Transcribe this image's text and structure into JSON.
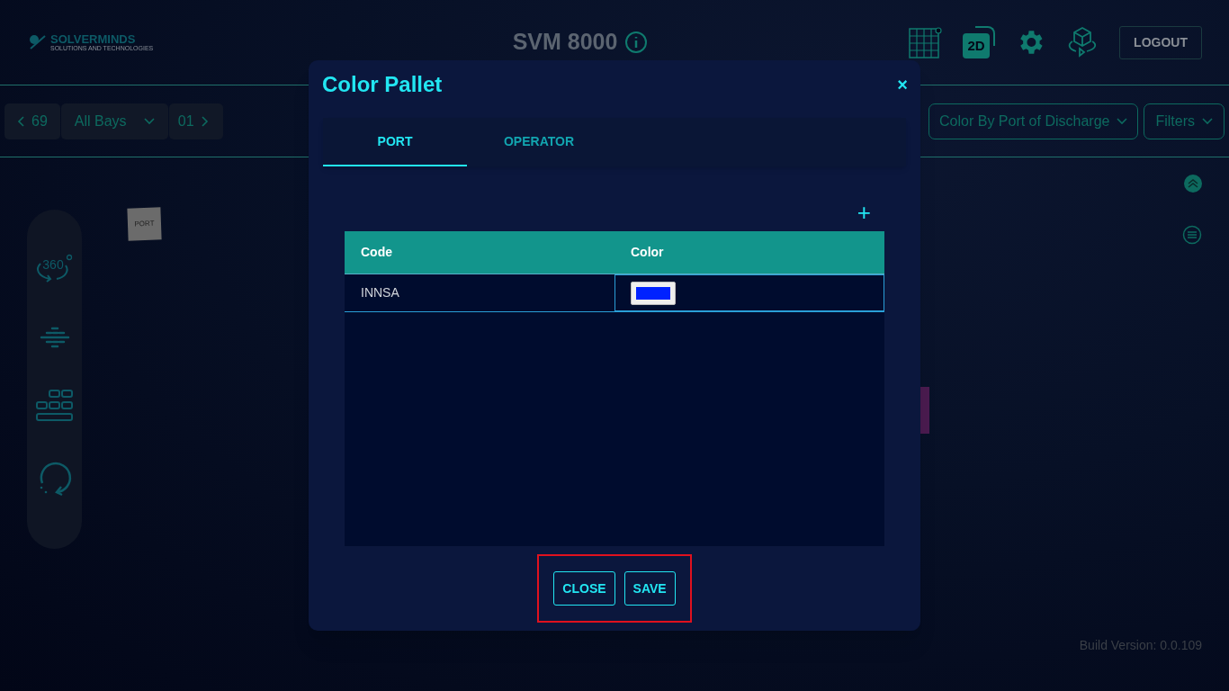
{
  "header": {
    "logo_name": "SOLVERMINDS",
    "logo_tagline": "SOLUTIONS AND TECHNOLOGIES",
    "title": "SVM 8000",
    "view_2d": "2D",
    "logout": "LOGOUT"
  },
  "toolbar": {
    "bay_prev": "69",
    "bay_select": "All Bays",
    "bay_next": "01",
    "color_by": "Color By Port of Discharge",
    "filters": "Filters"
  },
  "side_tools": {
    "rotate_label": "360"
  },
  "scene": {
    "port_label": "PORT"
  },
  "build_version": "Build Version: 0.0.109",
  "dialog": {
    "title": "Color Pallet",
    "close_icon": "×",
    "tabs": [
      {
        "label": "PORT",
        "selected": true
      },
      {
        "label": "OPERATOR",
        "selected": false
      }
    ],
    "add_icon": "+",
    "table": {
      "columns": [
        "Code",
        "Color"
      ],
      "rows": [
        {
          "code": "INNSA",
          "color": "#0022ff"
        }
      ]
    },
    "buttons": [
      "CLOSE",
      "SAVE"
    ]
  }
}
